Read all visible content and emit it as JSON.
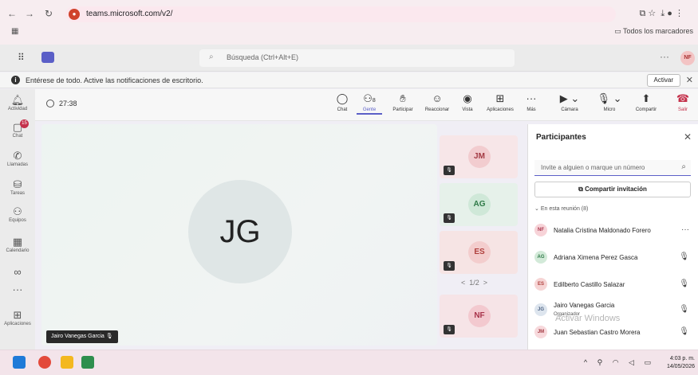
{
  "browser": {
    "url": "teams.microsoft.com/v2/",
    "bookmarks_folder": "Todos los marcadores"
  },
  "header": {
    "search_placeholder": "Búsqueda (Ctrl+Alt+E)",
    "avatar_initials": "NF"
  },
  "notification": {
    "text": "Entérese de todo. Active las notificaciones de escritorio.",
    "activate_label": "Activar"
  },
  "rail": [
    {
      "label": "Actividad",
      "icon": "bell-icon"
    },
    {
      "label": "Chat",
      "icon": "chat-icon",
      "badge": "15"
    },
    {
      "label": "Llamadas",
      "icon": "phone-icon"
    },
    {
      "label": "Tareas",
      "icon": "tasks-icon"
    },
    {
      "label": "Equipos",
      "icon": "teams-icon"
    },
    {
      "label": "Calendario",
      "icon": "calendar-icon"
    },
    {
      "label": "",
      "icon": "loop-icon"
    },
    {
      "label": "",
      "icon": "more-icon"
    },
    {
      "label": "Aplicaciones",
      "icon": "add-icon"
    }
  ],
  "meeting": {
    "timer": "27:38",
    "people_count": "8",
    "tools": {
      "chat": "Chat",
      "people": "Gente",
      "raise": "Participar",
      "react": "Reaccionar",
      "view": "Vista",
      "apps": "Aplicaciones",
      "more": "Más",
      "camera": "Cámara",
      "mic": "Micro",
      "share": "Compartir",
      "leave": "Salir"
    },
    "main_speaker": {
      "initials": "JG",
      "name": "Jairo Vanegas Garcia"
    },
    "tiles": [
      {
        "initials": "JM",
        "bg": "#f7e6e8",
        "av": "#f2cccf",
        "color": "#a33a43"
      },
      {
        "initials": "AG",
        "bg": "#e6f1ea",
        "av": "#cfe8d8",
        "color": "#2f7a48"
      },
      {
        "initials": "ES",
        "bg": "#f6e4e4",
        "av": "#f3cdcd",
        "color": "#b0413e"
      },
      {
        "initials": "NF",
        "bg": "#f6e4e7",
        "av": "#f3c9cf",
        "color": "#a8334a"
      }
    ],
    "pager": "1/2"
  },
  "panel": {
    "title": "Participantes",
    "invite_placeholder": "Invite a alguien o marque un número",
    "share_invite": "Compartir invitación",
    "section": "En esta reunión (8)",
    "participants": [
      {
        "initials": "NF",
        "name": "Natalia Cristina Maldonado Forero",
        "role": "",
        "action": "···",
        "av": "#f7d3d8",
        "color": "#a8334a"
      },
      {
        "initials": "AG",
        "name": "Adriana Ximena Perez Gasca",
        "role": "",
        "action": "mic-off",
        "av": "#d3ead9",
        "color": "#2f7a48"
      },
      {
        "initials": "ES",
        "name": "Edilberto Castillo Salazar",
        "role": "",
        "action": "mic-off",
        "av": "#f6d5d5",
        "color": "#b0413e"
      },
      {
        "initials": "JG",
        "name": "Jairo Vanegas Garcia",
        "role": "Organizador",
        "action": "mic-off",
        "av": "#dde5ee",
        "color": "#4a5f80"
      },
      {
        "initials": "JM",
        "name": "Juan Sebastian Castro Morera",
        "role": "",
        "action": "mic-off",
        "av": "#f7d9dc",
        "color": "#a33a43"
      }
    ],
    "watermark": "Activar Windows"
  },
  "taskbar": {
    "time": "4:03 p. m.",
    "date": "14/05/2026"
  }
}
